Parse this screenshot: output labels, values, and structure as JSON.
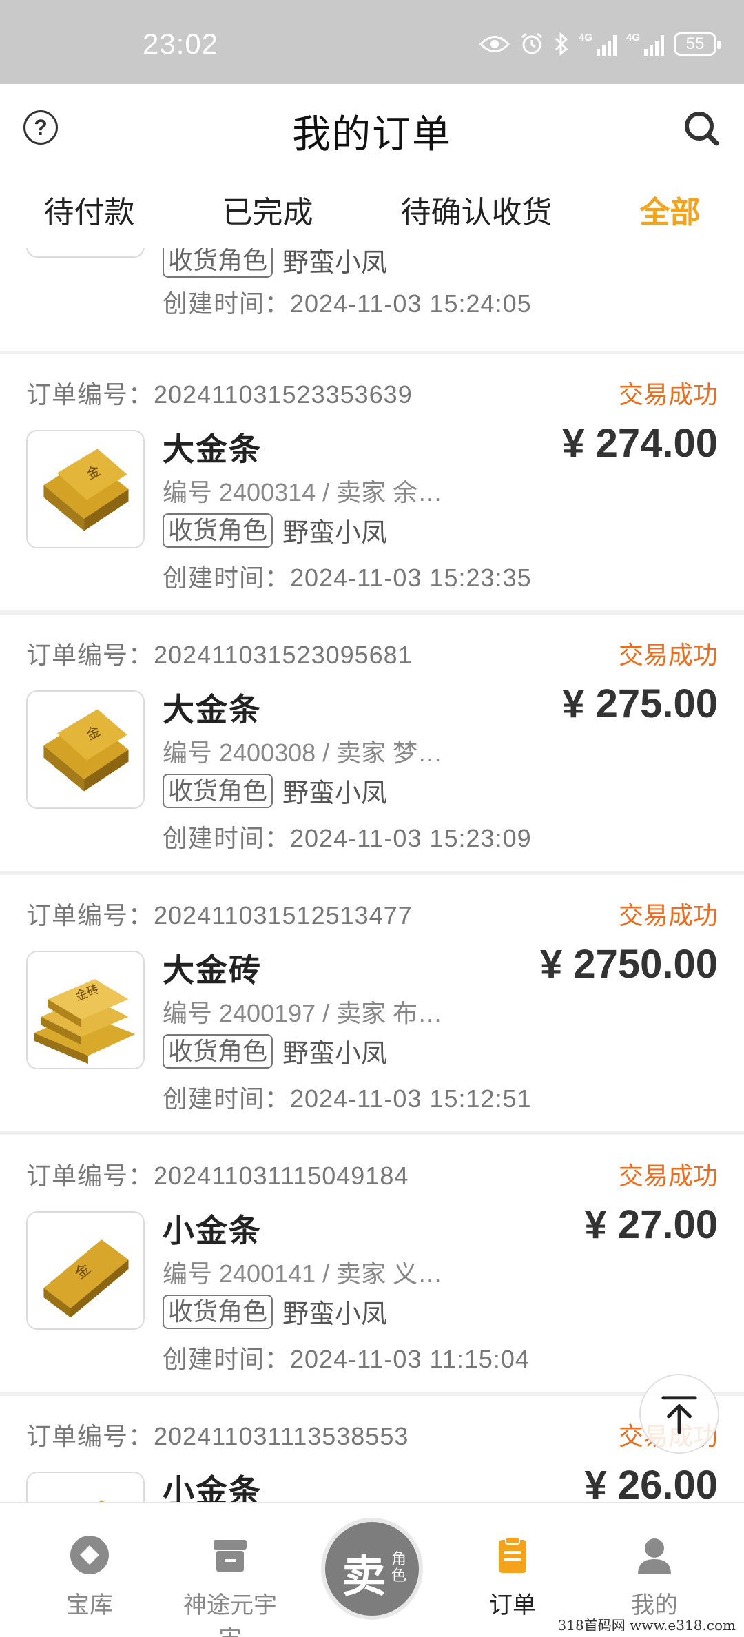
{
  "status_bar": {
    "time": "23:02",
    "battery": "55"
  },
  "header": {
    "title": "我的订单"
  },
  "tabs": [
    {
      "label": "待付款",
      "active": false
    },
    {
      "label": "已完成",
      "active": false
    },
    {
      "label": "待确认收货",
      "active": false
    },
    {
      "label": "全部",
      "active": true
    }
  ],
  "partial_top_card": {
    "role_tag": "收货角色",
    "role_name": "野蛮小凤",
    "created": "创建时间：2024-11-03 15:24:05"
  },
  "orders": [
    {
      "order_no": "订单编号：20241103152335363​9",
      "status": "交易成功",
      "name": "大金条",
      "price": "¥ 274.00",
      "info": "编号 2400314 / 卖家 余…",
      "role_tag": "收货角色",
      "role_name": "野蛮小凤",
      "created": "创建时间：2024-11-03 15:23:35",
      "image": "bars"
    },
    {
      "order_no": "订单编号：20241103152309568​1",
      "status": "交易成功",
      "name": "大金条",
      "price": "¥ 275.00",
      "info": "编号 2400308 / 卖家 梦…",
      "role_tag": "收货角色",
      "role_name": "野蛮小凤",
      "created": "创建时间：2024-11-03 15:23:09",
      "image": "bars"
    },
    {
      "order_no": "订单编号：20241103151251347​7",
      "status": "交易成功",
      "name": "大金砖",
      "price": "¥ 2750.00",
      "info": "编号 2400197 / 卖家 布…",
      "role_tag": "收货角色",
      "role_name": "野蛮小凤",
      "created": "创建时间：2024-11-03 15:12:51",
      "image": "bricks"
    },
    {
      "order_no": "订单编号：20241103111504918​4",
      "status": "交易成功",
      "name": "小金条",
      "price": "¥ 27.00",
      "info": "编号 2400141 / 卖家 义…",
      "role_tag": "收货角色",
      "role_name": "野蛮小凤",
      "created": "创建时间：2024-11-03 11:15:04",
      "image": "single"
    },
    {
      "order_no": "订单编号：20241103111353855​3",
      "status": "交易成功",
      "name": "小金条",
      "price": "¥ 26.00",
      "info": "",
      "role_tag": "",
      "role_name": "",
      "created": "",
      "image": "single"
    }
  ],
  "bottom_nav": [
    {
      "label": "宝库",
      "icon": "diamond-icon",
      "active": false
    },
    {
      "label": "神途元宇宙",
      "icon": "store-icon",
      "active": false
    },
    {
      "label": "订单",
      "icon": "clipboard-icon",
      "active": true
    },
    {
      "label": "我的",
      "icon": "person-icon",
      "active": false
    }
  ],
  "sell_button": {
    "big": "卖",
    "small": "角色"
  },
  "watermark": "318首码网 www.e318.com",
  "colors": {
    "accent": "#f5a31a",
    "status": "#ef6c1a",
    "gold": "#c9961c"
  }
}
